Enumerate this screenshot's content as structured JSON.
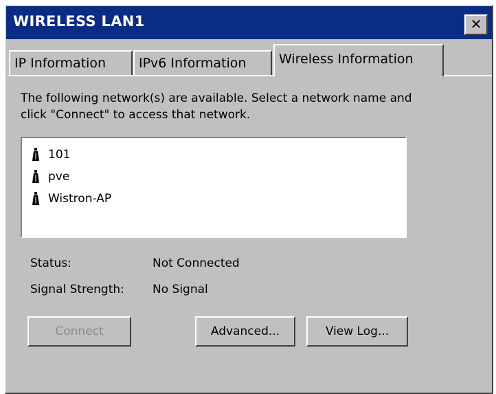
{
  "window": {
    "title": "WIRELESS LAN1",
    "close_label": "✕"
  },
  "tabs": [
    {
      "label": "IP Information",
      "active": false
    },
    {
      "label": "IPv6 Information",
      "active": false
    },
    {
      "label": "Wireless Information",
      "active": true
    }
  ],
  "intro_text": "The following network(s) are available. Select a network name and click \"Connect\" to access that network.",
  "networks": [
    {
      "name": "101",
      "icon": "antenna-icon"
    },
    {
      "name": "pve",
      "icon": "antenna-icon"
    },
    {
      "name": "Wistron-AP",
      "icon": "antenna-icon"
    }
  ],
  "status": {
    "label": "Status:",
    "value": "Not Connected"
  },
  "signal": {
    "label": "Signal Strength:",
    "value": "No Signal"
  },
  "buttons": {
    "connect": "Connect",
    "advanced": "Advanced...",
    "view_log": "View Log..."
  },
  "colors": {
    "titlebar": "#0a2c84",
    "face": "#c0c0c0",
    "disabled_text": "#8a8a8a"
  }
}
